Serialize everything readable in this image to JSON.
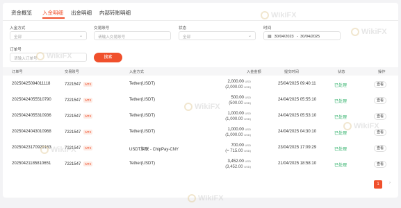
{
  "tabs": [
    {
      "label": "资金概览"
    },
    {
      "label": "入金明细"
    },
    {
      "label": "出金明细"
    },
    {
      "label": "内部转账明细"
    }
  ],
  "filters": {
    "deposit_method_label": "入金方式",
    "deposit_method_value": "全部",
    "account_label": "交易账号",
    "account_placeholder": "请输入交易账号",
    "status_label": "状态",
    "status_value": "全部",
    "time_label": "时间",
    "date_from": "30/04/2023",
    "date_sep": "-",
    "date_to": "30/04/2025",
    "order_label": "订单号",
    "order_placeholder": "请输入订单号",
    "search_label": "搜索"
  },
  "table": {
    "headers": [
      "订单号",
      "交易账号",
      "入金方式",
      "入金金额",
      "提交时间",
      "状态",
      "操作"
    ],
    "rows": [
      {
        "order": "20250425094011118",
        "account": "7221547",
        "tag": "MT4",
        "method": "Tether(USDT)",
        "amount": "2,000.00",
        "amount_cur": "USD",
        "amount_sub": "(2,000.00",
        "amount_sub_cur": "USD)",
        "time": "25/04/2025 09:40:11",
        "status": "已处理",
        "action": "查看"
      },
      {
        "order": "20250424055510790",
        "account": "7221547",
        "tag": "MT4",
        "method": "Tether(USDT)",
        "amount": "500.00",
        "amount_cur": "USD",
        "amount_sub": "(500.00",
        "amount_sub_cur": "USD)",
        "time": "24/04/2025 05:55:10",
        "status": "已处理",
        "action": "查看"
      },
      {
        "order": "20250424055310936",
        "account": "7221547",
        "tag": "MT4",
        "method": "Tether(USDT)",
        "amount": "1,000.00",
        "amount_cur": "USD",
        "amount_sub": "(1,000.00",
        "amount_sub_cur": "USD)",
        "time": "24/04/2025 05:53:10",
        "status": "已处理",
        "action": "查看"
      },
      {
        "order": "20250424043010968",
        "account": "7221547",
        "tag": "MT4",
        "method": "Tether(USDT)",
        "amount": "1,000.00",
        "amount_cur": "USD",
        "amount_sub": "(1,000.00",
        "amount_sub_cur": "USD)",
        "time": "24/04/2025 04:30:10",
        "status": "已处理",
        "action": "查看"
      },
      {
        "order": "20250423170929163",
        "account": "7221547",
        "tag": "MT4",
        "method": "USDT旗联 - ChipPay-CNY",
        "amount": "700.00",
        "amount_cur": "USD",
        "amount_sub": "(≈ 715.00",
        "amount_sub_cur": "USD)",
        "time": "23/04/2025 17:09:29",
        "status": "已处理",
        "action": "查看"
      },
      {
        "order": "20250421185810651",
        "account": "7221547",
        "tag": "MT4",
        "method": "Tether(USDT)",
        "amount": "3,452.00",
        "amount_cur": "USD",
        "amount_sub": "(3,452.00",
        "amount_sub_cur": "USD)",
        "time": "21/04/2025 18:58:10",
        "status": "已处理",
        "action": "查看"
      }
    ]
  },
  "pagination": {
    "current": "1",
    "next": "›"
  },
  "watermark": "WikiFX",
  "colors": {
    "accent": "#f0502c",
    "status_done": "#36b36e"
  }
}
